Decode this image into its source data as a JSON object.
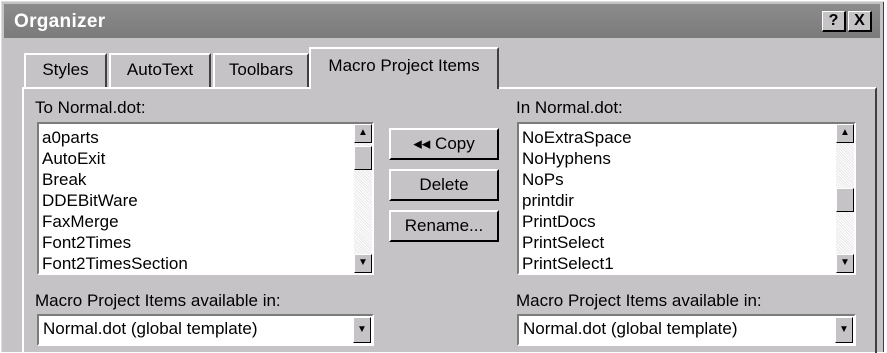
{
  "window": {
    "title": "Organizer",
    "help_glyph": "?",
    "close_glyph": "X"
  },
  "tabs": [
    {
      "label": "Styles",
      "active": false
    },
    {
      "label": "AutoText",
      "active": false
    },
    {
      "label": "Toolbars",
      "active": false
    },
    {
      "label": "Macro Project Items",
      "active": true
    }
  ],
  "left": {
    "label": "To Normal.dot:",
    "items": [
      "a0parts",
      "AutoExit",
      "Break",
      "DDEBitWare",
      "FaxMerge",
      "Font2Times",
      "Font2TimesSection"
    ],
    "avail_label": "Macro Project Items available in:",
    "avail_value": "Normal.dot (global template)"
  },
  "right": {
    "label": "In Normal.dot:",
    "items": [
      "NoExtraSpace",
      "NoHyphens",
      "NoPs",
      "printdir",
      "PrintDocs",
      "PrintSelect",
      "PrintSelect1"
    ],
    "avail_label": "Macro Project Items available in:",
    "avail_value": "Normal.dot (global template)"
  },
  "buttons": {
    "copy": "◂◂ Copy",
    "delete": "Delete",
    "rename": "Rename..."
  },
  "icons": {
    "scroll_up": "scroll-up-arrow-icon",
    "scroll_down": "scroll-down-arrow-icon",
    "dropdown": "dropdown-arrow-icon"
  },
  "colors": {
    "face": "#c6c3c6",
    "titlebar": "#808080"
  }
}
